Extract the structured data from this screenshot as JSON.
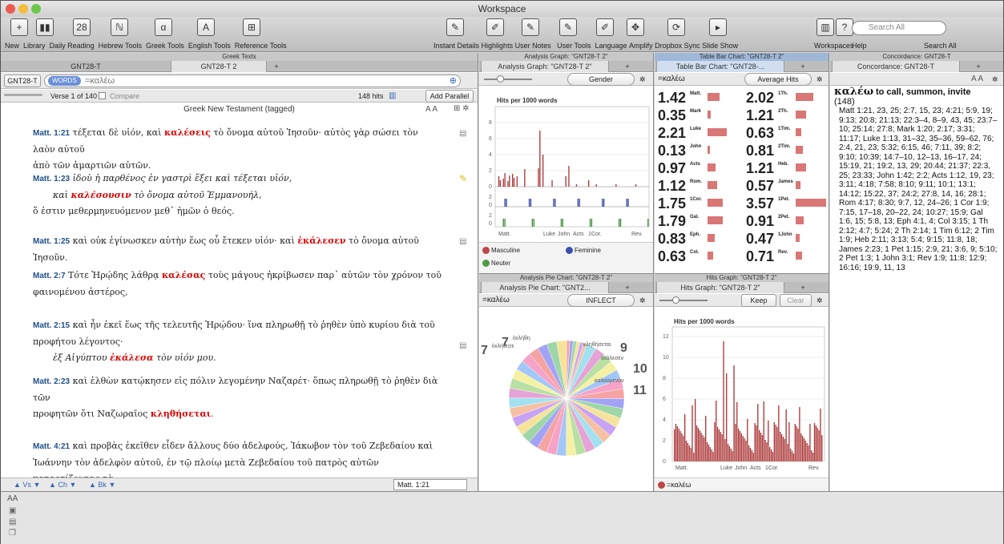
{
  "window": {
    "title": "Workspace"
  },
  "toolbar": {
    "items": [
      {
        "label": "New",
        "icon": "plus-doc-icon"
      },
      {
        "label": "Library",
        "icon": "books-icon"
      },
      {
        "label": "Daily Reading",
        "icon": "calendar-icon"
      },
      {
        "label": "Hebrew Tools",
        "icon": "hebrew-icon"
      },
      {
        "label": "Greek Tools",
        "icon": "greek-icon"
      },
      {
        "label": "English Tools",
        "icon": "english-icon"
      },
      {
        "label": "Reference Tools",
        "icon": "reference-icon"
      }
    ],
    "right_items": [
      {
        "label": "Instant Details"
      },
      {
        "label": "Highlights"
      },
      {
        "label": "User Notes"
      },
      {
        "label": "User Tools"
      },
      {
        "label": "Language"
      },
      {
        "label": "Amplify"
      },
      {
        "label": "Dropbox Sync"
      },
      {
        "label": "Slide Show"
      },
      {
        "label": "Workspaces"
      },
      {
        "label": "Help"
      },
      {
        "label": "Search All"
      }
    ],
    "search_placeholder": "Search All"
  },
  "text_pane": {
    "header": "Greek Texts",
    "tab_left": "GNT28-T",
    "tab_active": "GNT28-T 2",
    "module": "GNT28-T",
    "search_tag": "WORDS",
    "search_query": "=καλέω",
    "verse_counter": "Verse 1 of 140",
    "compare": "Compare",
    "hits": "148 hits",
    "add_parallel": "Add Parallel",
    "title": "Greek New Testament (tagged)",
    "verses": [
      {
        "ref": "Matt. 1:21",
        "pre": " τέξεται δὲ υἱόν, καὶ ",
        "hl": "καλέσεις",
        "post": " τὸ ὄνομα αὐτοῦ Ἰησοῦν· αὐτὸς γὰρ σώσει τὸν λαὸν αὐτοῦ",
        "l2": "ἀπὸ τῶν ἁμαρτιῶν αὐτῶν."
      },
      {
        "ref": "Matt. 1:23",
        "pre": " ἰδοὺ ἡ παρθένος ἐν γαστρὶ ἕξει καὶ τέξεται υἱόν,",
        "l2pre": "καὶ ",
        "hl": "καλέσουσιν",
        "l2post": " τὸ ὄνομα αὐτοῦ Ἐμμανουήλ,",
        "l3": "ὅ ἐστιν μεθερμηνευόμενον μεθ᾽ ἡμῶν ὁ θεός."
      },
      {
        "ref": "Matt. 1:25",
        "pre": " καὶ οὐκ ἐγίνωσκεν αὐτὴν ἕως οὗ ἔτεκεν υἱόν· καὶ ",
        "hl": "ἐκάλεσεν",
        "post": " τὸ ὄνομα αὐτοῦ Ἰησοῦν."
      },
      {
        "ref": "Matt. 2:7",
        "pre": " Τότε Ἡρῴδης λάθρᾳ ",
        "hl": "καλέσας",
        "post": " τοὺς μάγους ἠκρίβωσεν παρ᾽ αὐτῶν τὸν χρόνον τοῦ",
        "l2": "φαινομένου ἀστέρος,"
      },
      {
        "ref": "Matt. 2:15",
        "pre": " καὶ ἦν ἐκεῖ ἕως τῆς τελευτῆς Ἡρῴδου· ἵνα πληρωθῇ τὸ ῥηθὲν ὑπὸ κυρίου διὰ τοῦ",
        "l2": "προφήτου λέγοντος·",
        "l3pre": "ἐξ Αἰγύπτου ",
        "hl": "ἐκάλεσα",
        "l3post": " τὸν υἱόν μου."
      },
      {
        "ref": "Matt. 2:23",
        "pre": " καὶ ἐλθὼν κατῴκησεν εἰς πόλιν λεγομένην Ναζαρέτ· ὅπως πληρωθῇ τὸ ῥηθὲν διὰ τῶν",
        "l2pre": "προφητῶν ὅτι Ναζωραῖος ",
        "hl": "κληθήσεται",
        "l2post": "."
      },
      {
        "ref": "Matt. 4:21",
        "pre": " καὶ προβὰς ἐκεῖθεν εἶδεν ἄλλους δύο ἀδελφούς, Ἰάκωβον τὸν τοῦ Ζεβεδαίου καὶ",
        "l2": "Ἰωάννην τὸν ἀδελφὸν αὐτοῦ, ἐν τῷ πλοίῳ μετὰ Ζεβεδαίου τοῦ πατρὸς αὐτῶν καταρτίζοντας τὰ"
      }
    ],
    "footer": {
      "vs": "Vs",
      "ch": "Ch",
      "bk": "Bk",
      "ref": "Matt. 1:21"
    }
  },
  "graph_pane": {
    "header": "Analysis Graph: \"GNT28-T 2\"",
    "tab": "Analysis Graph: \"GNT28-T 2\"",
    "field": "Gender",
    "chart_title": "Hits per 1000 words",
    "xlabels": [
      "Matt.",
      "Luke",
      "John",
      "Acts",
      "1Cor.",
      "Rev."
    ],
    "legend": [
      {
        "name": "Masculine",
        "color": "#c04545"
      },
      {
        "name": "Feminine",
        "color": "#3a4fb0"
      },
      {
        "name": "Neuter",
        "color": "#4f9a45"
      }
    ],
    "yticks_top": [
      "8",
      "6",
      "4",
      "2",
      "0"
    ],
    "yticks_mid": [
      "2",
      "0"
    ],
    "yticks_bot": [
      "2",
      "0"
    ]
  },
  "tablebar_pane": {
    "header": "Table Bar Chart: \"GNT28-T 2\"",
    "tab": "Table Bar Chart: \"GNT28-...",
    "query": "=καλέω",
    "field": "Average Hits",
    "rows": [
      [
        {
          "v": "1.42",
          "b": "Matt.",
          "w": 0.4
        },
        {
          "v": "2.02",
          "b": "1Th.",
          "w": 0.57
        }
      ],
      [
        {
          "v": "0.35",
          "b": "Mark",
          "w": 0.1
        },
        {
          "v": "1.21",
          "b": "2Th.",
          "w": 0.34
        }
      ],
      [
        {
          "v": "2.21",
          "b": "Luke",
          "w": 0.62
        },
        {
          "v": "0.63",
          "b": "1Tim.",
          "w": 0.18
        }
      ],
      [
        {
          "v": "0.13",
          "b": "John",
          "w": 0.04
        },
        {
          "v": "0.81",
          "b": "2Tim.",
          "w": 0.23
        }
      ],
      [
        {
          "v": "0.97",
          "b": "Acts",
          "w": 0.27
        },
        {
          "v": "1.21",
          "b": "Heb.",
          "w": 0.34
        }
      ],
      [
        {
          "v": "1.12",
          "b": "Rom.",
          "w": 0.31
        },
        {
          "v": "0.57",
          "b": "James",
          "w": 0.16
        }
      ],
      [
        {
          "v": "1.75",
          "b": "1Cor.",
          "w": 0.49
        },
        {
          "v": "3.57",
          "b": "1Pet.",
          "w": 1.0
        }
      ],
      [
        {
          "v": "1.79",
          "b": "Gal.",
          "w": 0.5
        },
        {
          "v": "0.91",
          "b": "2Pet.",
          "w": 0.25
        }
      ],
      [
        {
          "v": "0.83",
          "b": "Eph.",
          "w": 0.23
        },
        {
          "v": "0.47",
          "b": "1John",
          "w": 0.13
        }
      ],
      [
        {
          "v": "0.63",
          "b": "Col.",
          "w": 0.18
        },
        {
          "v": "0.71",
          "b": "Rev.",
          "w": 0.2
        }
      ]
    ]
  },
  "pie_pane": {
    "header": "Analysis Pie Chart: \"GNT28-T 2\"",
    "tab": "Analysis Pie Chart: \"GNT2...",
    "query": "=καλέω",
    "field": "INFLECT",
    "labels": [
      {
        "n": "7",
        "w": "ἐκλήθητε"
      },
      {
        "n": "7",
        "w": "ἐκλήθη"
      },
      {
        "n": "9",
        "w": "κληθήσεται"
      },
      {
        "n": "10",
        "w": "ἐκάλεσεν"
      },
      {
        "n": "11",
        "w": "καλούμενον"
      }
    ]
  },
  "hits_pane": {
    "header": "Hits Graph: \"GNT28-T 2\"",
    "tab": "Hits Graph: \"GNT28-T 2\"",
    "keep": "Keep",
    "clear": "Clear",
    "chart_title": "Hits per 1000 words",
    "xlabels": [
      "Matt.",
      "Luke",
      "John",
      "Acts",
      "1Cor.",
      "Rev."
    ],
    "yticks": [
      "12",
      "10",
      "8",
      "6",
      "4",
      "2",
      "0"
    ],
    "legend": "=καλέω"
  },
  "conc_pane": {
    "header": "Concordance: GNT28-T",
    "tab": "Concordance: GNT28-T",
    "lemma": "καλέω",
    "gloss": "to call, summon, invite",
    "count": "(148)",
    "refs": "Matt 1:21, 23, 25; 2:7, 15, 23; 4:21; 5:9, 19; 9:13; 20:8; 21:13; 22:3–4, 8–9, 43, 45; 23:7–10; 25:14; 27:8; Mark 1:20; 2:17; 3:31; 11:17; Luke 1:13, 31–32, 35–36, 59–62, 76; 2:4, 21, 23; 5:32; 6:15, 46; 7:11, 39; 8:2; 9:10; 10:39; 14:7–10, 12–13, 16–17, 24; 15:19, 21; 19:2, 13, 29; 20:44; 21:37; 22:3, 25; 23:33; John 1:42; 2:2; Acts 1:12, 19, 23; 3:11; 4:18; 7:58; 8:10; 9:11; 10:1; 13:1; 14:12; 15:22, 37; 24:2; 27:8, 14, 16; 28:1; Rom 4:17; 8:30; 9:7, 12, 24–26; 1 Cor 1:9; 7:15, 17–18, 20–22, 24; 10:27; 15:9; Gal 1:6, 15; 5:8, 13; Eph 4:1, 4; Col 3:15; 1 Th 2:12; 4:7; 5:24; 2 Th 2:14; 1 Tim 6:12; 2 Tim 1:9; Heb 2:11; 3:13; 5:4; 9:15; 11:8, 18; James 2:23; 1 Pet 1:15; 2:9, 21; 3:6, 9; 5:10; 2 Pet 1:3; 1 John 3:1; Rev 1:9; 11:8; 12:9; 16:16; 19:9, 11, 13"
  },
  "bottom": {
    "aa": "AA"
  }
}
